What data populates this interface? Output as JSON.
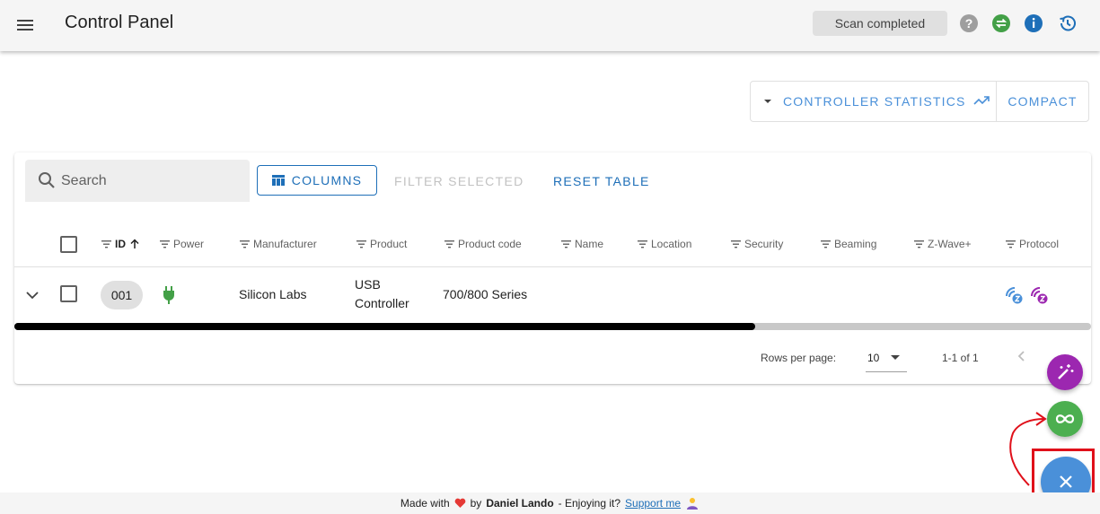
{
  "appbar": {
    "title": "Control Panel",
    "status": "Scan completed",
    "icons": [
      "menu-icon",
      "help-icon",
      "sync-icon",
      "info-icon",
      "history-icon"
    ]
  },
  "view_toggle": {
    "stats_label": "CONTROLLER STATISTICS",
    "compact_label": "COMPACT"
  },
  "toolbar": {
    "search_placeholder": "Search",
    "columns_label": "COLUMNS",
    "filter_selected_label": "FILTER SELECTED",
    "reset_table_label": "RESET TABLE"
  },
  "table": {
    "headers": [
      "ID",
      "Power",
      "Manufacturer",
      "Product",
      "Product code",
      "Name",
      "Location",
      "Security",
      "Beaming",
      "Z-Wave+",
      "Protocol"
    ],
    "rows": [
      {
        "id": "001",
        "power": "plug-icon",
        "manufacturer": "Silicon Labs",
        "product_line1": "USB",
        "product_line2": "Controller",
        "product_code": "700/800 Series",
        "name": "",
        "location": "",
        "security": "",
        "beaming": "",
        "zwave_plus": "",
        "protocol": [
          "zwave-icon",
          "zwave-lr-icon"
        ]
      }
    ]
  },
  "pagination": {
    "rows_per_page_label": "Rows per page:",
    "rows_per_page": "10",
    "range": "1-1 of 1"
  },
  "fab": {
    "actions": [
      "magic-wand-icon",
      "infinity-icon"
    ],
    "main": "close-icon"
  },
  "footer": {
    "made_with": "Made with",
    "by": "by",
    "author": "Daniel Lando",
    "enjoying": "- Enjoying it?",
    "support": "Support me"
  },
  "colors": {
    "primary": "#1e6fb8",
    "accent_blue": "#4a90d9",
    "purple": "#9c27b0",
    "green": "#4caf50",
    "highlight": "#e0101a"
  }
}
